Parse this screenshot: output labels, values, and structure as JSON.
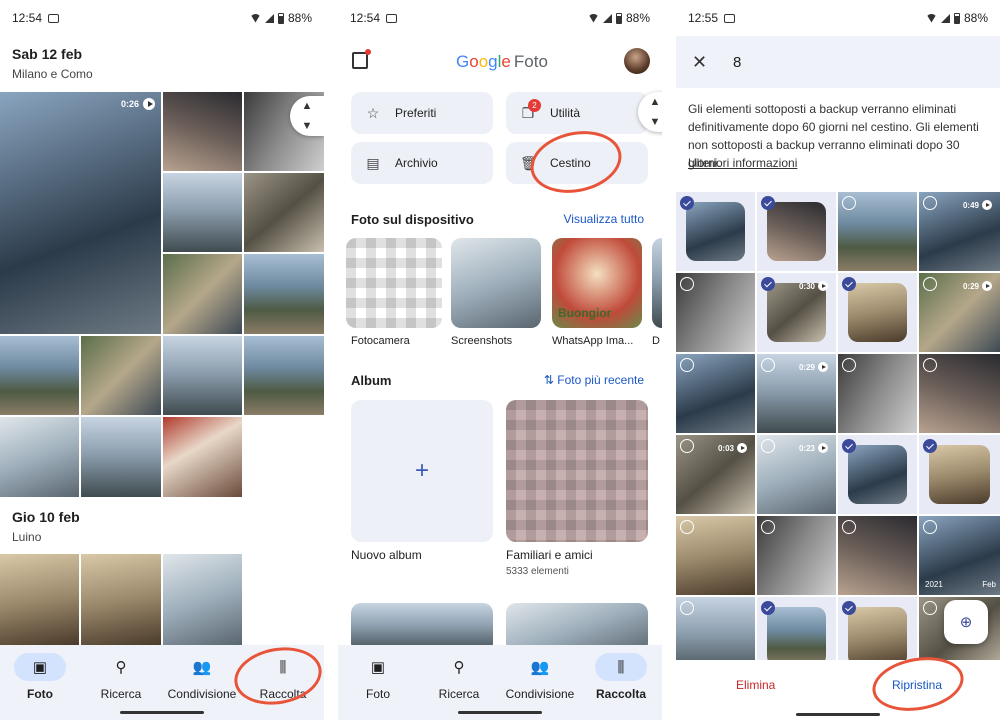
{
  "status": {
    "p1_time": "12:54",
    "p2_time": "12:54",
    "p3_time": "12:55",
    "battery": "88%"
  },
  "nav": {
    "foto": "Foto",
    "ricerca": "Ricerca",
    "condivisione": "Condivisione",
    "raccolta": "Raccolta"
  },
  "screen1": {
    "group1": {
      "date": "Sab 12 feb",
      "place": "Milano e Como"
    },
    "group2": {
      "date": "Gio 10 feb",
      "place": "Luino"
    },
    "video_duration": "0:26"
  },
  "screen2": {
    "logo": {
      "g": "G",
      "o1": "o",
      "o2": "o",
      "g2": "g",
      "l": "l",
      "e": "e",
      "foto": "Foto"
    },
    "buttons": {
      "preferiti": "Preferiti",
      "utilita": "Utilità",
      "utilita_badge": "2",
      "archivio": "Archivio",
      "cestino": "Cestino"
    },
    "device_section": {
      "title": "Foto sul dispositivo",
      "link": "Visualizza tutto"
    },
    "device_items": [
      "Fotocamera",
      "Screenshots",
      "WhatsApp Ima...",
      "D"
    ],
    "album_section": {
      "title": "Album",
      "sort": "Foto più recente"
    },
    "albums": [
      {
        "name": "Nuovo album",
        "count": ""
      },
      {
        "name": "Familiari e amici",
        "count": "5333 elementi"
      }
    ],
    "whatsapp_text": "Buongior"
  },
  "screen3": {
    "selected_count": "8",
    "info_text": "Gli elementi sottoposti a backup verranno eliminati definitivamente dopo 60 giorni nel cestino. Gli elementi non sottoposti a backup verranno eliminati dopo 30 giorni.",
    "info_link": "Ulteriori informazioni",
    "actions": {
      "delete": "Elimina",
      "restore": "Ripristina"
    },
    "durations": {
      "r0c3": "0:49",
      "r1c1": "0:30",
      "r1c3": "0:29",
      "r2c1": "0:29",
      "r3c0": "0:03",
      "r3c1": "0:23"
    },
    "year_label": "2021",
    "corner_label": "Feb"
  },
  "colors": {
    "accent_blue": "#1a57c5",
    "check_blue": "#3b4a9a",
    "annotation_red": "#e8543a",
    "delete_red": "#c62828",
    "nav_bg": "#f0f2f9"
  }
}
